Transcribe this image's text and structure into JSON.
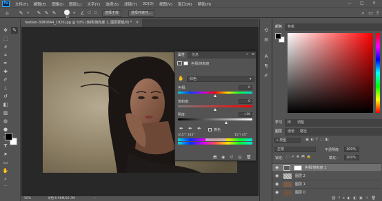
{
  "menubar": {
    "logo": "Ps",
    "items": [
      "文件(F)",
      "编辑(E)",
      "图像(I)",
      "图层(L)",
      "文字(Y)",
      "选择(S)",
      "滤镜(T)",
      "3D(D)",
      "视图(V)",
      "窗口(W)",
      "帮助(H)"
    ],
    "minimize": "—",
    "maximize": "□",
    "close": "✕"
  },
  "options": {
    "brush_size": "15",
    "select_subject": "选择主体",
    "select_mask": "选择并遮住..."
  },
  "document": {
    "tab_title": "fashion-3080644_1920.jpg @ 50% (色相/饱和度 1, 图层蒙版/8) *",
    "tab_close": "×",
    "zoom": "50%",
    "doc_info": "文档:6.98M/20.3M"
  },
  "properties": {
    "tab_properties": "属性",
    "tab_info": "信息",
    "title": "色相/饱和度",
    "preset_value": "红色",
    "hue_label": "色相:",
    "hue_value": "0",
    "saturation_label": "饱和度:",
    "saturation_value": "0",
    "lightness_label": "明度:",
    "lightness_value": "+30",
    "colorize_label": "着色",
    "range_left": "315°/ 345°",
    "range_right": "15°\\ 45°"
  },
  "color_panel": {
    "tab_color": "颜色",
    "tab_swatches": "色板",
    "foreground": "#000000",
    "background": "#ffffff"
  },
  "mid_panel": {
    "tab_learn": "学习",
    "tab_libraries": "库",
    "tab_adjust": "调整"
  },
  "layers_panel": {
    "tab_layers": "图层",
    "tab_channels": "通道",
    "tab_paths": "路径",
    "filter_kind": "类型",
    "blend_mode": "正常",
    "opacity_label": "不透明度:",
    "opacity_value": "100%",
    "lock_label": "锁定:",
    "fill_label": "填充:",
    "fill_value": "100%",
    "layers": [
      {
        "name": "色相/饱和度 1",
        "selected": true
      },
      {
        "name": "图层 2",
        "selected": false
      },
      {
        "name": "图层 1",
        "selected": false
      },
      {
        "name": "图层 0",
        "selected": false
      }
    ]
  }
}
